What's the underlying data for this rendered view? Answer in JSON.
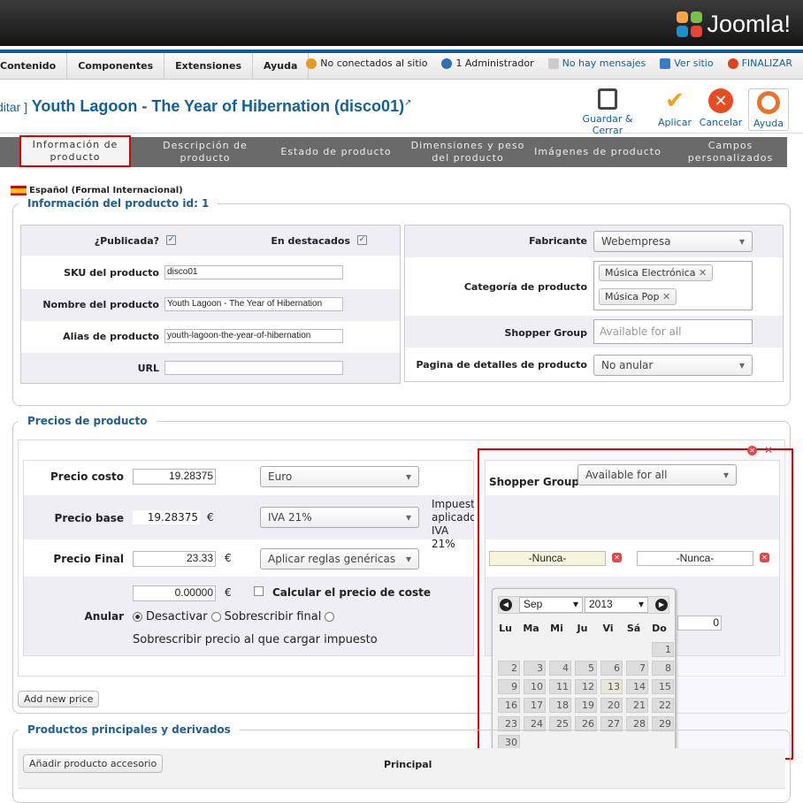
{
  "brand": {
    "logo_text": "Joomla!"
  },
  "menu": [
    "Contenido",
    "Componentes",
    "Extensiones",
    "Ayuda"
  ],
  "status": {
    "visitors": "No conectados al sitio",
    "admins": "1 Administrador",
    "messages": "No hay mensajes",
    "view_site": "Ver sitio",
    "logout": "FINALIZAR"
  },
  "title": {
    "prefix": "ditar ]",
    "text": "Youth Lagoon - The Year of Hibernation (disco01)"
  },
  "toolbar": {
    "save_close": "Guardar & Cerrar",
    "apply": "Aplicar",
    "cancel": "Cancelar",
    "help": "Ayuda"
  },
  "tabs": [
    "Información de producto",
    "Descripción de producto",
    "Estado de producto",
    "Dimensiones y peso del producto",
    "Imágenes de producto",
    "Campos personalizados"
  ],
  "language": "Español (Formal Internacional)",
  "info": {
    "legend": "Información del producto id: 1",
    "published_label": "¿Publicada?",
    "featured_label": "En destacados",
    "sku_label": "SKU del producto",
    "sku_value": "disco01",
    "name_label": "Nombre del producto",
    "name_value": "Youth Lagoon - The Year of Hibernation",
    "alias_label": "Alias de producto",
    "alias_value": "youth-lagoon-the-year-of-hibernation",
    "url_label": "URL",
    "url_value": "",
    "manufacturer_label": "Fabricante",
    "manufacturer_value": "Webempresa",
    "category_label": "Categoría de producto",
    "categories": [
      "Música Electrónica",
      "Música Pop"
    ],
    "shopper_label": "Shopper Group",
    "shopper_placeholder": "Available for all",
    "details_label": "Pagina de detalles de producto",
    "details_value": "No anular"
  },
  "prices": {
    "legend": "Precios de producto",
    "cost_label": "Precio costo",
    "cost_value": "19.28375",
    "currency": "Euro",
    "base_label": "Precio base",
    "base_value": "19.28375",
    "euro_sign": "€",
    "tax": "IVA 21%",
    "tax_note_1": "Impuesto",
    "tax_note_2": "aplicado:",
    "tax_note_3": "IVA 21%",
    "final_label": "Precio Final",
    "final_value": "23.33",
    "rules": "Aplicar reglas genéricas",
    "override_value": "0.00000",
    "calc_cost": "Calcular el precio de coste",
    "override_label": "Anular",
    "opt_disable": "Desactivar",
    "opt_override": "Sobrescribir final",
    "opt_tax": "Sobrescribir precio al que cargar impuesto",
    "shopper_label": "Shopper Group",
    "shopper_value": "Available for all",
    "date_from": "-Nunca-",
    "date_to": "-Nunca-",
    "qty_value": "0",
    "add_price": "Add new price"
  },
  "calendar": {
    "month": "Sep",
    "year": "2013",
    "weekdays": [
      "Lu",
      "Ma",
      "Mi",
      "Ju",
      "Vi",
      "Sá",
      "Do"
    ],
    "days": [
      "1",
      "2",
      "3",
      "4",
      "5",
      "6",
      "7",
      "8",
      "9",
      "10",
      "11",
      "12",
      "13",
      "14",
      "15",
      "16",
      "17",
      "18",
      "19",
      "20",
      "21",
      "22",
      "23",
      "24",
      "25",
      "26",
      "27",
      "28",
      "29",
      "30"
    ],
    "today": "13"
  },
  "related": {
    "legend": "Productos principales y derivados",
    "add_button": "Añadir producto accesorio",
    "col_main": "Principal"
  }
}
